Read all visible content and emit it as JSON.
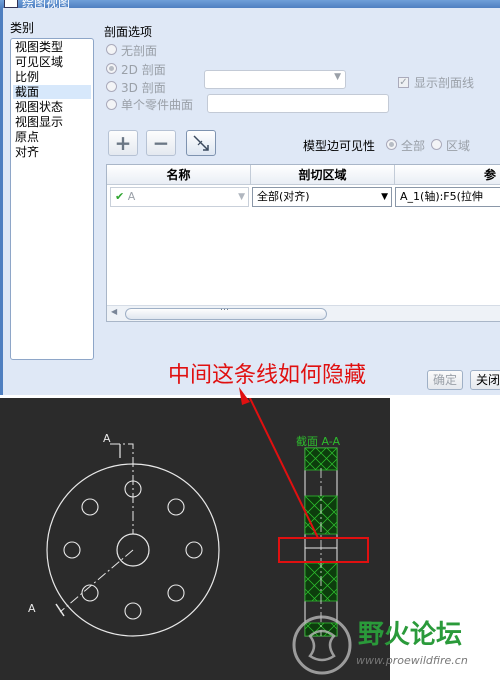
{
  "dialog": {
    "title": "绘图视图",
    "category": {
      "label": "类别",
      "items": [
        "视图类型",
        "可见区域",
        "比例",
        "截面",
        "视图状态",
        "视图显示",
        "原点",
        "对齐"
      ],
      "selected": 3
    },
    "section_options": {
      "label": "剖面选项",
      "no_section": "无剖面",
      "section_2d": "2D 剖面",
      "section_3d": "3D 剖面",
      "single_part_surface": "单个零件曲面",
      "show_section_line": "显示剖面线"
    },
    "toolbar": {
      "add": "+",
      "remove": "−"
    },
    "edge_visibility": {
      "label": "模型边可见性",
      "all": "全部",
      "area": "区域"
    },
    "table": {
      "headers": [
        "名称",
        "剖切区域",
        "参"
      ],
      "row": {
        "name": "A",
        "region": "全部(对齐)",
        "ref": "A_1(轴):F5(拉伸"
      }
    },
    "buttons": {
      "ok": "确定",
      "close": "关闭"
    }
  },
  "annotation": {
    "text": "中间这条线如何隐藏",
    "color": "#e01010"
  },
  "drawing": {
    "section_title": "截面 A-A",
    "cut_label_top": "A",
    "cut_label_bottom": "A"
  },
  "watermark": {
    "brand": "野火论坛",
    "url": "www.proewildfire.cn"
  }
}
